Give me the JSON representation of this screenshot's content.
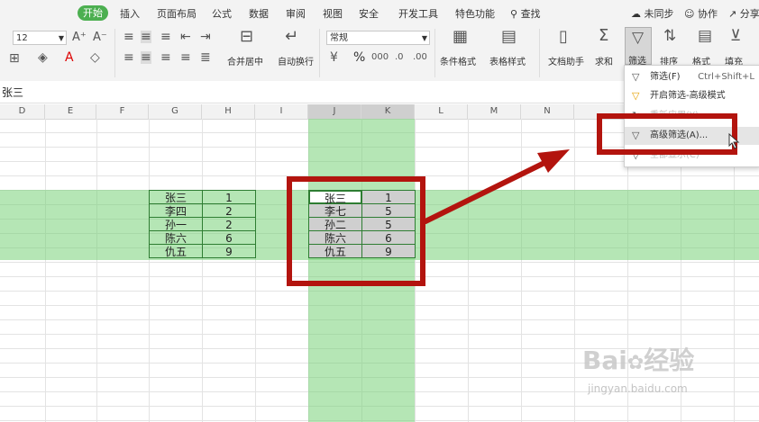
{
  "menu": {
    "active_tab": "开始",
    "tabs": [
      "插入",
      "页面布局",
      "公式",
      "数据",
      "审阅",
      "视图",
      "安全",
      "开发工具",
      "特色功能"
    ],
    "search_label": "查找",
    "sync_label": "未同步",
    "collab_label": "协作",
    "share_label": "分享"
  },
  "ribbon": {
    "font_size": "12",
    "number_format": "常规",
    "merge_label": "合并居中",
    "wrap_label": "自动换行",
    "percent_symbol": "%",
    "cond_format_label": "条件格式",
    "table_style_label": "表格样式",
    "doc_assistant_label": "文档助手",
    "sum_label": "求和",
    "filter_label": "筛选",
    "sort_label": "排序",
    "format_label": "格式",
    "fill_label": "填充"
  },
  "namebar": {
    "cell_content": "张三"
  },
  "columns": [
    "D",
    "E",
    "F",
    "G",
    "H",
    "I",
    "J",
    "K",
    "L",
    "M",
    "N"
  ],
  "table_left": {
    "names": [
      "张三",
      "李四",
      "孙一",
      "陈六",
      "仇五"
    ],
    "values": [
      "1",
      "2",
      "2",
      "6",
      "9"
    ]
  },
  "table_right": {
    "names": [
      "张三",
      "李七",
      "孙二",
      "陈六",
      "仇五"
    ],
    "values": [
      "1",
      "5",
      "5",
      "6",
      "9"
    ]
  },
  "dropdown": {
    "items": [
      {
        "label": "筛选(F)",
        "shortcut": "Ctrl+Shift+L"
      },
      {
        "label": "开启筛选-高级模式",
        "shortcut": ""
      },
      {
        "label": "重新应用(Y)",
        "shortcut": ""
      },
      {
        "label": "高级筛选(A)...",
        "shortcut": ""
      },
      {
        "label": "全部显示(C)",
        "shortcut": ""
      }
    ]
  },
  "watermark": {
    "brand": "Bai",
    "brand_cn": "经验",
    "url": "jingyan.baidu.com"
  },
  "colors": {
    "accent": "#4caf50",
    "highlight": "#9de09d",
    "annotation": "#b3140e"
  }
}
